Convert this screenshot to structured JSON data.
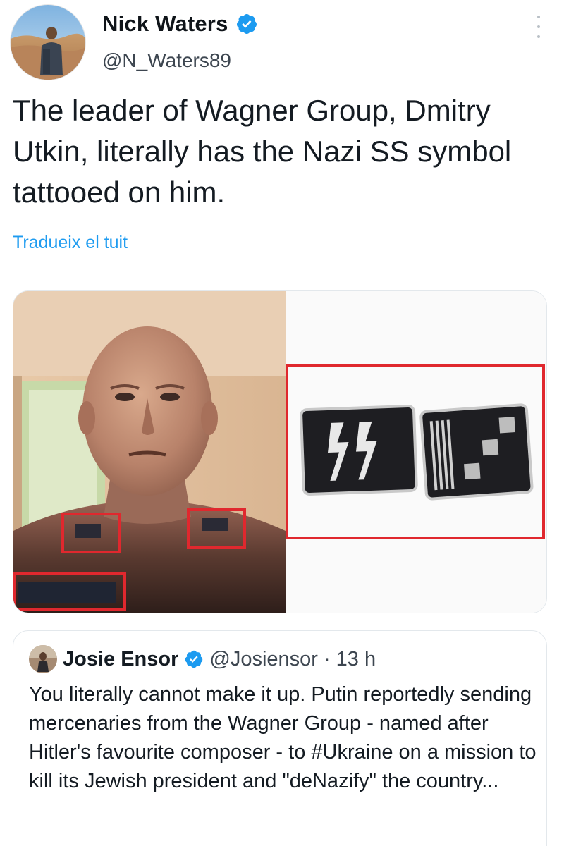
{
  "author": {
    "name": "Nick Waters",
    "handle": "@N_Waters89",
    "verified": true,
    "avatar_icon": "profile-photo-desert"
  },
  "tweet": {
    "text": "The leader of Wagner Group, Dmitry Utkin, literally has the Nazi SS symbol tattooed on him.",
    "translate_label": "Tradueix el tuit"
  },
  "media": {
    "left_image": "photo-shirtless-man-with-highlighted-tattoos",
    "right_image": "ss-collar-insignia-patches",
    "highlight_color": "#e0282e"
  },
  "quoted_tweet": {
    "name": "Josie Ensor",
    "handle": "@Josiensor",
    "separator": "·",
    "time": "13 h",
    "verified": true,
    "text": "You literally cannot make it up. Putin reportedly sending mercenaries from the Wagner Group - named after Hitler's favourite composer - to #Ukraine on a mission to kill its Jewish president and \"deNazify\" the country..."
  },
  "colors": {
    "link": "#1d9bf0",
    "verified_badge": "#1d9bf0",
    "border": "#e3e8ec"
  }
}
